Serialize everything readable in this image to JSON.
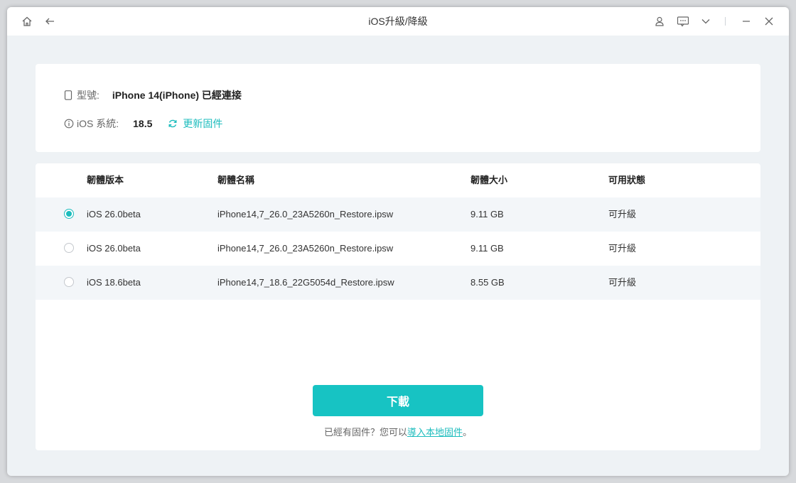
{
  "window": {
    "title": "iOS升級/降級"
  },
  "device": {
    "model_label": "型號:",
    "model_value": "iPhone 14(iPhone) 已經連接",
    "ios_label": "iOS 系統:",
    "ios_value": "18.5",
    "update_link": "更新固件"
  },
  "table": {
    "headers": [
      "韌體版本",
      "韌體名稱",
      "韌體大小",
      "可用狀態"
    ],
    "rows": [
      {
        "version": "iOS 26.0beta",
        "name": "iPhone14,7_26.0_23A5260n_Restore.ipsw",
        "size": "9.11 GB",
        "status": "可升級",
        "selected": true
      },
      {
        "version": "iOS 26.0beta",
        "name": "iPhone14,7_26.0_23A5260n_Restore.ipsw",
        "size": "9.11 GB",
        "status": "可升級",
        "selected": false
      },
      {
        "version": "iOS 18.6beta",
        "name": "iPhone14,7_18.6_22G5054d_Restore.ipsw",
        "size": "8.55 GB",
        "status": "可升級",
        "selected": false
      }
    ]
  },
  "actions": {
    "download_label": "下載",
    "note_prefix": "已經有固件？您可以",
    "note_link": "導入本地固件",
    "note_suffix": "。"
  },
  "colors": {
    "accent": "#1cbcbd",
    "button": "#17c3c3"
  },
  "icons": [
    "home-icon",
    "back-arrow-icon",
    "user-icon",
    "feedback-icon",
    "chevron-down-icon",
    "minimize-icon",
    "close-icon",
    "phone-icon",
    "info-icon",
    "refresh-icon"
  ]
}
